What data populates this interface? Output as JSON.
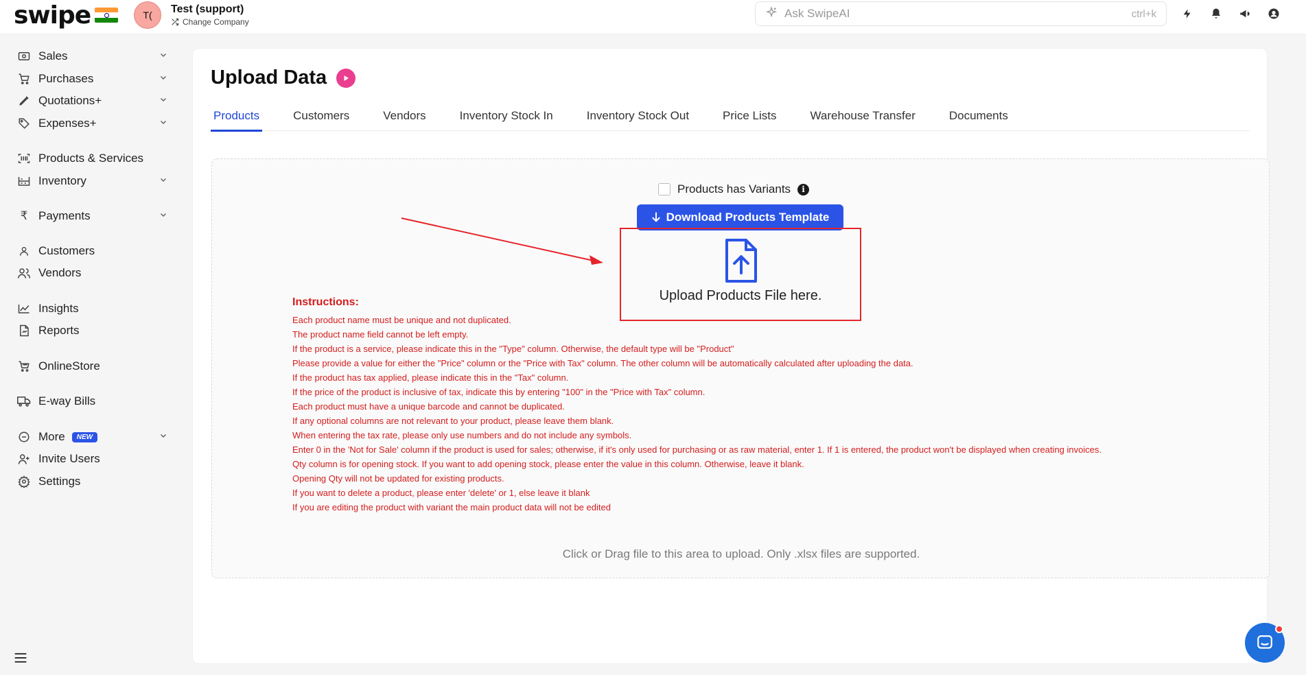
{
  "brand": {
    "logo_text": "swipe"
  },
  "company": {
    "avatar_initials": "T(",
    "name": "Test (support)",
    "change_label": "Change Company"
  },
  "search": {
    "placeholder": "Ask SwipeAI",
    "shortcut": "ctrl+k"
  },
  "topbar_icons": [
    "lightning-icon",
    "bell-icon",
    "megaphone-icon",
    "user-circle-icon"
  ],
  "sidebar": {
    "items": [
      {
        "label": "Sales",
        "icon": "cash-icon",
        "has_chevron": true
      },
      {
        "label": "Purchases",
        "icon": "cart-icon",
        "has_chevron": true
      },
      {
        "label": "Quotations+",
        "icon": "pencil-icon",
        "has_chevron": true
      },
      {
        "label": "Expenses+",
        "icon": "tag-icon",
        "has_chevron": true
      },
      {
        "label": "Products & Services",
        "icon": "barcode-icon",
        "has_chevron": false
      },
      {
        "label": "Inventory",
        "icon": "warehouse-icon",
        "has_chevron": true
      },
      {
        "label": "Payments",
        "icon": "rupee-icon",
        "has_chevron": true
      },
      {
        "label": "Customers",
        "icon": "user-icon",
        "has_chevron": false
      },
      {
        "label": "Vendors",
        "icon": "users-icon",
        "has_chevron": false
      },
      {
        "label": "Insights",
        "icon": "chart-line-icon",
        "has_chevron": false
      },
      {
        "label": "Reports",
        "icon": "file-report-icon",
        "has_chevron": false
      },
      {
        "label": "OnlineStore",
        "icon": "store-cart-icon",
        "has_chevron": false
      },
      {
        "label": "E-way Bills",
        "icon": "truck-icon",
        "has_chevron": false
      },
      {
        "label": "More",
        "icon": "minus-circle-icon",
        "has_chevron": true,
        "badge": "NEW"
      },
      {
        "label": "Invite Users",
        "icon": "user-plus-icon",
        "has_chevron": false
      },
      {
        "label": "Settings",
        "icon": "gear-icon",
        "has_chevron": false
      }
    ]
  },
  "page": {
    "title": "Upload Data"
  },
  "tabs": [
    {
      "label": "Products",
      "active": true
    },
    {
      "label": "Customers",
      "active": false
    },
    {
      "label": "Vendors",
      "active": false
    },
    {
      "label": "Inventory Stock In",
      "active": false
    },
    {
      "label": "Inventory Stock Out",
      "active": false
    },
    {
      "label": "Price Lists",
      "active": false
    },
    {
      "label": "Warehouse Transfer",
      "active": false
    },
    {
      "label": "Documents",
      "active": false
    }
  ],
  "upload": {
    "variants_label": "Products has Variants",
    "variants_checked": false,
    "download_button": "Download Products Template",
    "drop_text": "Upload Products File here.",
    "instructions_heading": "Instructions:",
    "instructions": [
      "Each product name must be unique and not duplicated.",
      "The product name field cannot be left empty.",
      "If the product is a service, please indicate this in the \"Type\" column. Otherwise, the default type will be \"Product\"",
      "Please provide a value for either the \"Price\" column or the \"Price with Tax\" column. The other column will be automatically calculated after uploading the data.",
      "If the product has tax applied, please indicate this in the \"Tax\" column.",
      "If the price of the product is inclusive of tax, indicate this by entering \"100\" in the \"Price with Tax\" column.",
      "Each product must have a unique barcode and cannot be duplicated.",
      "If any optional columns are not relevant to your product, please leave them blank.",
      "When entering the tax rate, please only use numbers and do not include any symbols.",
      "Enter 0 in the 'Not for Sale' column if the product is used for sales; otherwise, if it's only used for purchasing or as raw material, enter 1. If 1 is entered, the product won't be displayed when creating invoices.",
      "Qty column is for opening stock. If you want to add opening stock, please enter the value in this column. Otherwise, leave it blank.",
      "Opening Qty will not be updated for existing products.",
      "If you want to delete a product, please enter 'delete' or 1, else leave it blank",
      "If you are editing the product with variant the main product data will not be edited"
    ],
    "footnote": "Click or Drag file to this area to upload. Only .xlsx files are supported."
  },
  "colors": {
    "accent": "#2b54e6",
    "tab_active": "#2046d8",
    "instructions": "#d41d1d",
    "highlight_box": "#e5242a",
    "play_button": "#ea3e8e"
  }
}
